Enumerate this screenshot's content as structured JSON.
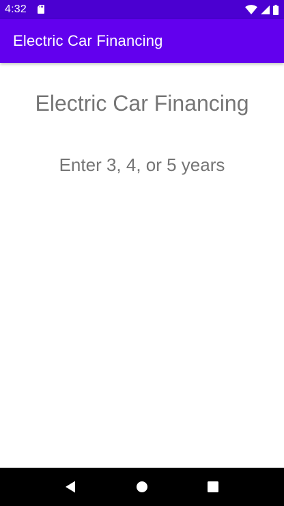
{
  "status_bar": {
    "time": "4:32",
    "color": "#4b00d1",
    "icons": [
      "sd-card-icon",
      "wifi-icon",
      "signal-icon",
      "battery-icon"
    ]
  },
  "app_bar": {
    "title": "Electric Car Financing",
    "color": "#6200ee"
  },
  "main": {
    "heading": "Electric Car Financing",
    "instruction": "Enter 3, 4, or 5 years"
  },
  "nav_bar": {
    "buttons": [
      "back-icon",
      "home-icon",
      "recents-icon"
    ]
  }
}
